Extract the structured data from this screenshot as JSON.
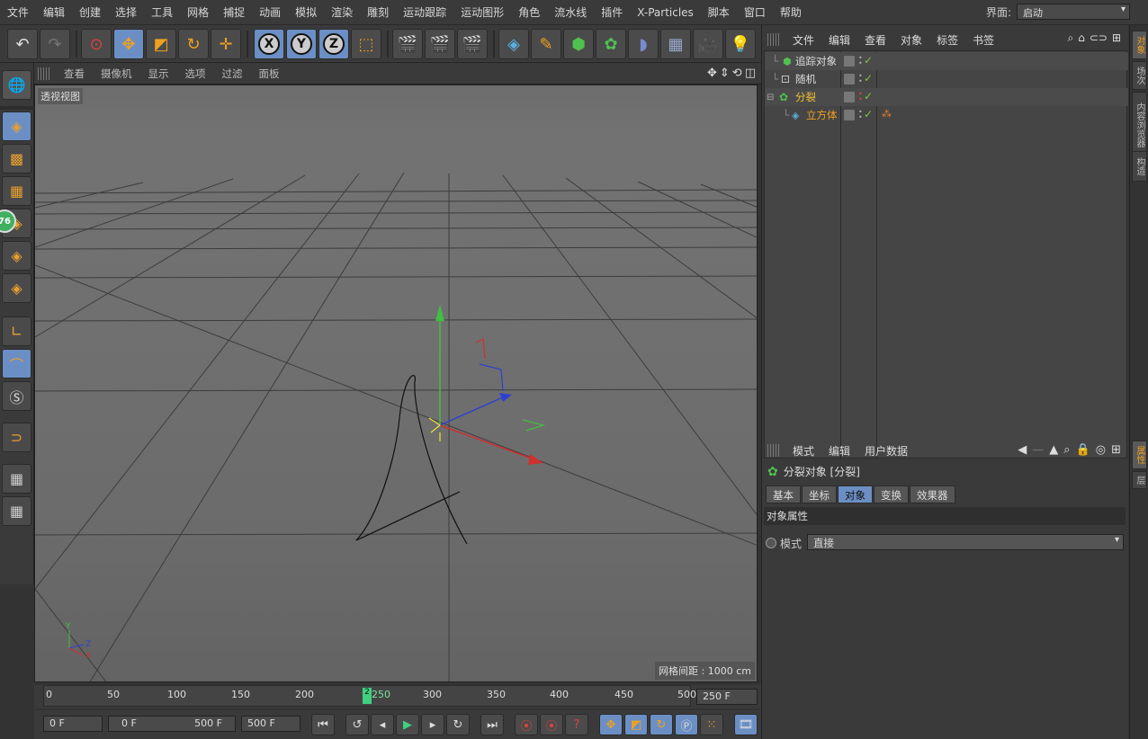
{
  "menubar": {
    "items": [
      "文件",
      "编辑",
      "创建",
      "选择",
      "工具",
      "网格",
      "捕捉",
      "动画",
      "模拟",
      "渲染",
      "雕刻",
      "运动跟踪",
      "运动图形",
      "角色",
      "流水线",
      "插件",
      "X-Particles",
      "脚本",
      "窗口",
      "帮助"
    ],
    "interface_label": "界面:",
    "interface_value": "启动"
  },
  "viewport": {
    "menu": [
      "查看",
      "摄像机",
      "显示",
      "选项",
      "过滤",
      "面板"
    ],
    "label": "透视视图",
    "grid_spacing": "网格间距 : 1000 cm",
    "axis_labels": {
      "y": "Y",
      "z": "Z",
      "x": "X"
    }
  },
  "left_palette": {
    "badge": "76"
  },
  "timeline": {
    "ticks": [
      "0",
      "50",
      "100",
      "150",
      "200",
      "250",
      "300",
      "350",
      "400",
      "450",
      "500"
    ],
    "current_frame_marker": "2",
    "end_field": "250 F",
    "start": "0 F",
    "range_start": "0 F",
    "range_end": "500 F",
    "max": "500 F"
  },
  "object_manager": {
    "menu": [
      "文件",
      "编辑",
      "查看",
      "对象",
      "标签",
      "书签"
    ],
    "objects": [
      {
        "name": "追踪对象",
        "color": "#dddddd"
      },
      {
        "name": "随机",
        "color": "#dddddd"
      },
      {
        "name": "分裂",
        "color": "#f0c030"
      },
      {
        "name": "立方体",
        "color": "#f0a020"
      }
    ]
  },
  "attribute_manager": {
    "menu": [
      "模式",
      "编辑",
      "用户数据"
    ],
    "title": "分裂对象 [分裂]",
    "tabs": [
      "基本",
      "坐标",
      "对象",
      "变换",
      "效果器"
    ],
    "active_tab": "对象",
    "section": "对象属性",
    "mode_label": "模式",
    "mode_value": "直接"
  },
  "side_tabs": {
    "top": [
      "对象",
      "场次",
      "内容浏览器",
      "构造"
    ],
    "bottom": [
      "属性",
      "层"
    ]
  },
  "colors": {
    "accent": "#6b8fc4",
    "orange": "#f0a020"
  }
}
